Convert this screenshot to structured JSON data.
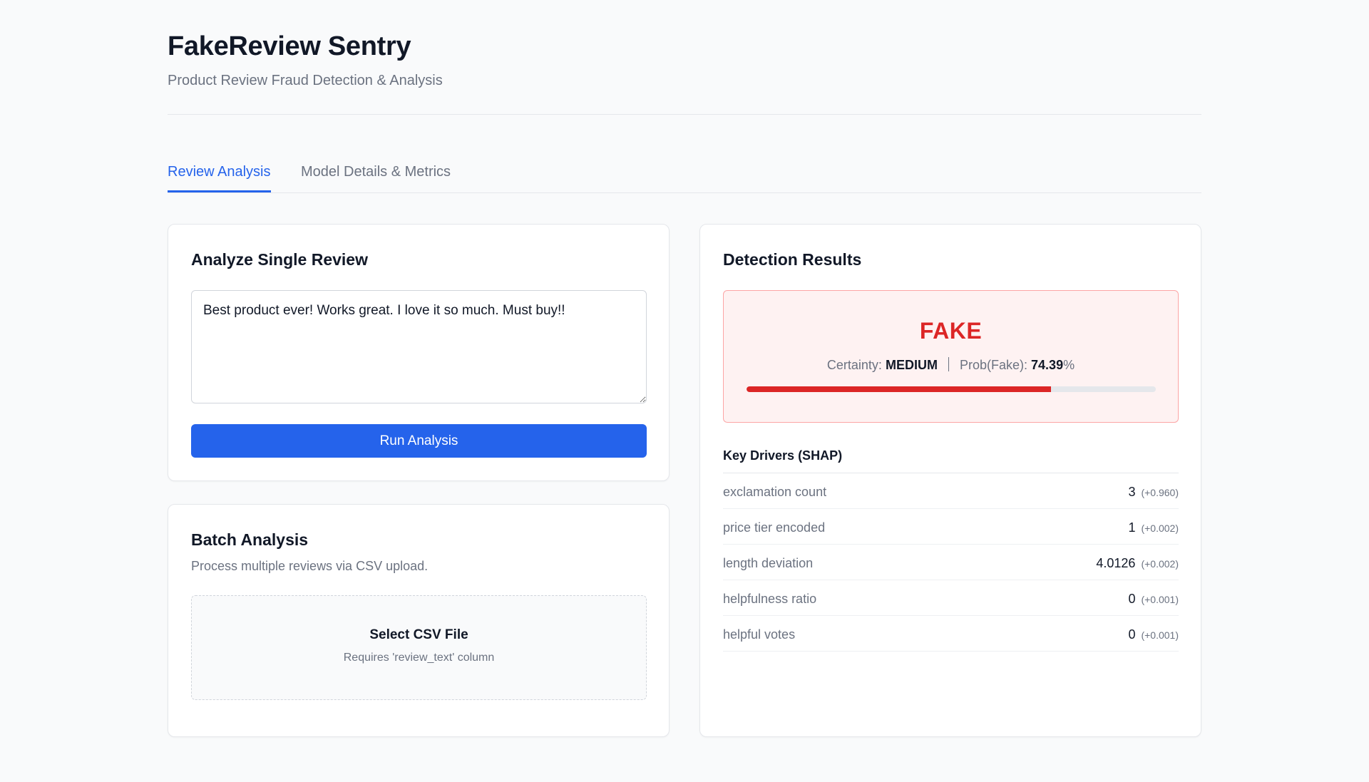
{
  "header": {
    "title": "FakeReview Sentry",
    "subtitle": "Product Review Fraud Detection & Analysis"
  },
  "tabs": [
    {
      "label": "Review Analysis",
      "active": true
    },
    {
      "label": "Model Details & Metrics",
      "active": false
    }
  ],
  "single_review": {
    "title": "Analyze Single Review",
    "text": "Best product ever! Works great. I love it so much. Must buy!!",
    "button_label": "Run Analysis"
  },
  "batch": {
    "title": "Batch Analysis",
    "description": "Process multiple reviews via CSV upload.",
    "dropzone_title": "Select CSV File",
    "dropzone_hint": "Requires 'review_text' column"
  },
  "results": {
    "title": "Detection Results",
    "verdict": "FAKE",
    "certainty_label": "Certainty:",
    "certainty_value": "MEDIUM",
    "prob_label": "Prob(Fake):",
    "prob_value": "74.39",
    "prob_unit": "%",
    "prob_fraction": 0.7439,
    "verdict_color": "#dc2626",
    "drivers_title": "Key Drivers (SHAP)",
    "drivers": [
      {
        "name": "exclamation count",
        "value": "3",
        "shap": "(+0.960)"
      },
      {
        "name": "price tier encoded",
        "value": "1",
        "shap": "(+0.002)"
      },
      {
        "name": "length deviation",
        "value": "4.0126",
        "shap": "(+0.002)"
      },
      {
        "name": "helpfulness ratio",
        "value": "0",
        "shap": "(+0.001)"
      },
      {
        "name": "helpful votes",
        "value": "0",
        "shap": "(+0.001)"
      }
    ]
  },
  "colors": {
    "accent": "#2563eb",
    "fake": "#dc2626",
    "fake_bg": "#fef2f2"
  }
}
